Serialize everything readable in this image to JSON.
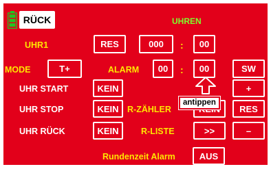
{
  "header": {
    "back_label": "RÜCK",
    "title": "UHREN",
    "battery_icon": "battery-icon"
  },
  "uhr1": {
    "label": "UHR1",
    "res_label": "RES",
    "minutes": "000",
    "seconds": "00",
    "separator": ":"
  },
  "mode": {
    "label": "MODE",
    "value": "T+"
  },
  "alarm": {
    "label": "ALARM",
    "minutes": "00",
    "seconds": "00",
    "separator": ":"
  },
  "side": {
    "sw_label": "SW",
    "plus_label": "+",
    "res_label": "RES",
    "minus_label": "–"
  },
  "uhr_start": {
    "label": "UHR START",
    "value": "KEIN"
  },
  "uhr_stop": {
    "label": "UHR STOP",
    "value": "KEIN"
  },
  "uhr_rueck": {
    "label": "UHR RÜCK",
    "value": "KEIN"
  },
  "r_zaehler": {
    "label": "R-ZÄHLER",
    "value": "KEIN"
  },
  "r_liste": {
    "label": "R-LISTE",
    "value": ">>"
  },
  "rundenzeit": {
    "label": "Rundenzeit Alarm",
    "value": "AUS"
  },
  "annotation": {
    "label": "antippen"
  },
  "colors": {
    "background": "#e2001a",
    "label_yellow": "#ffe600",
    "title_green": "#7dff2d",
    "battery_green": "#22c422",
    "outline_white": "#ffffff"
  }
}
